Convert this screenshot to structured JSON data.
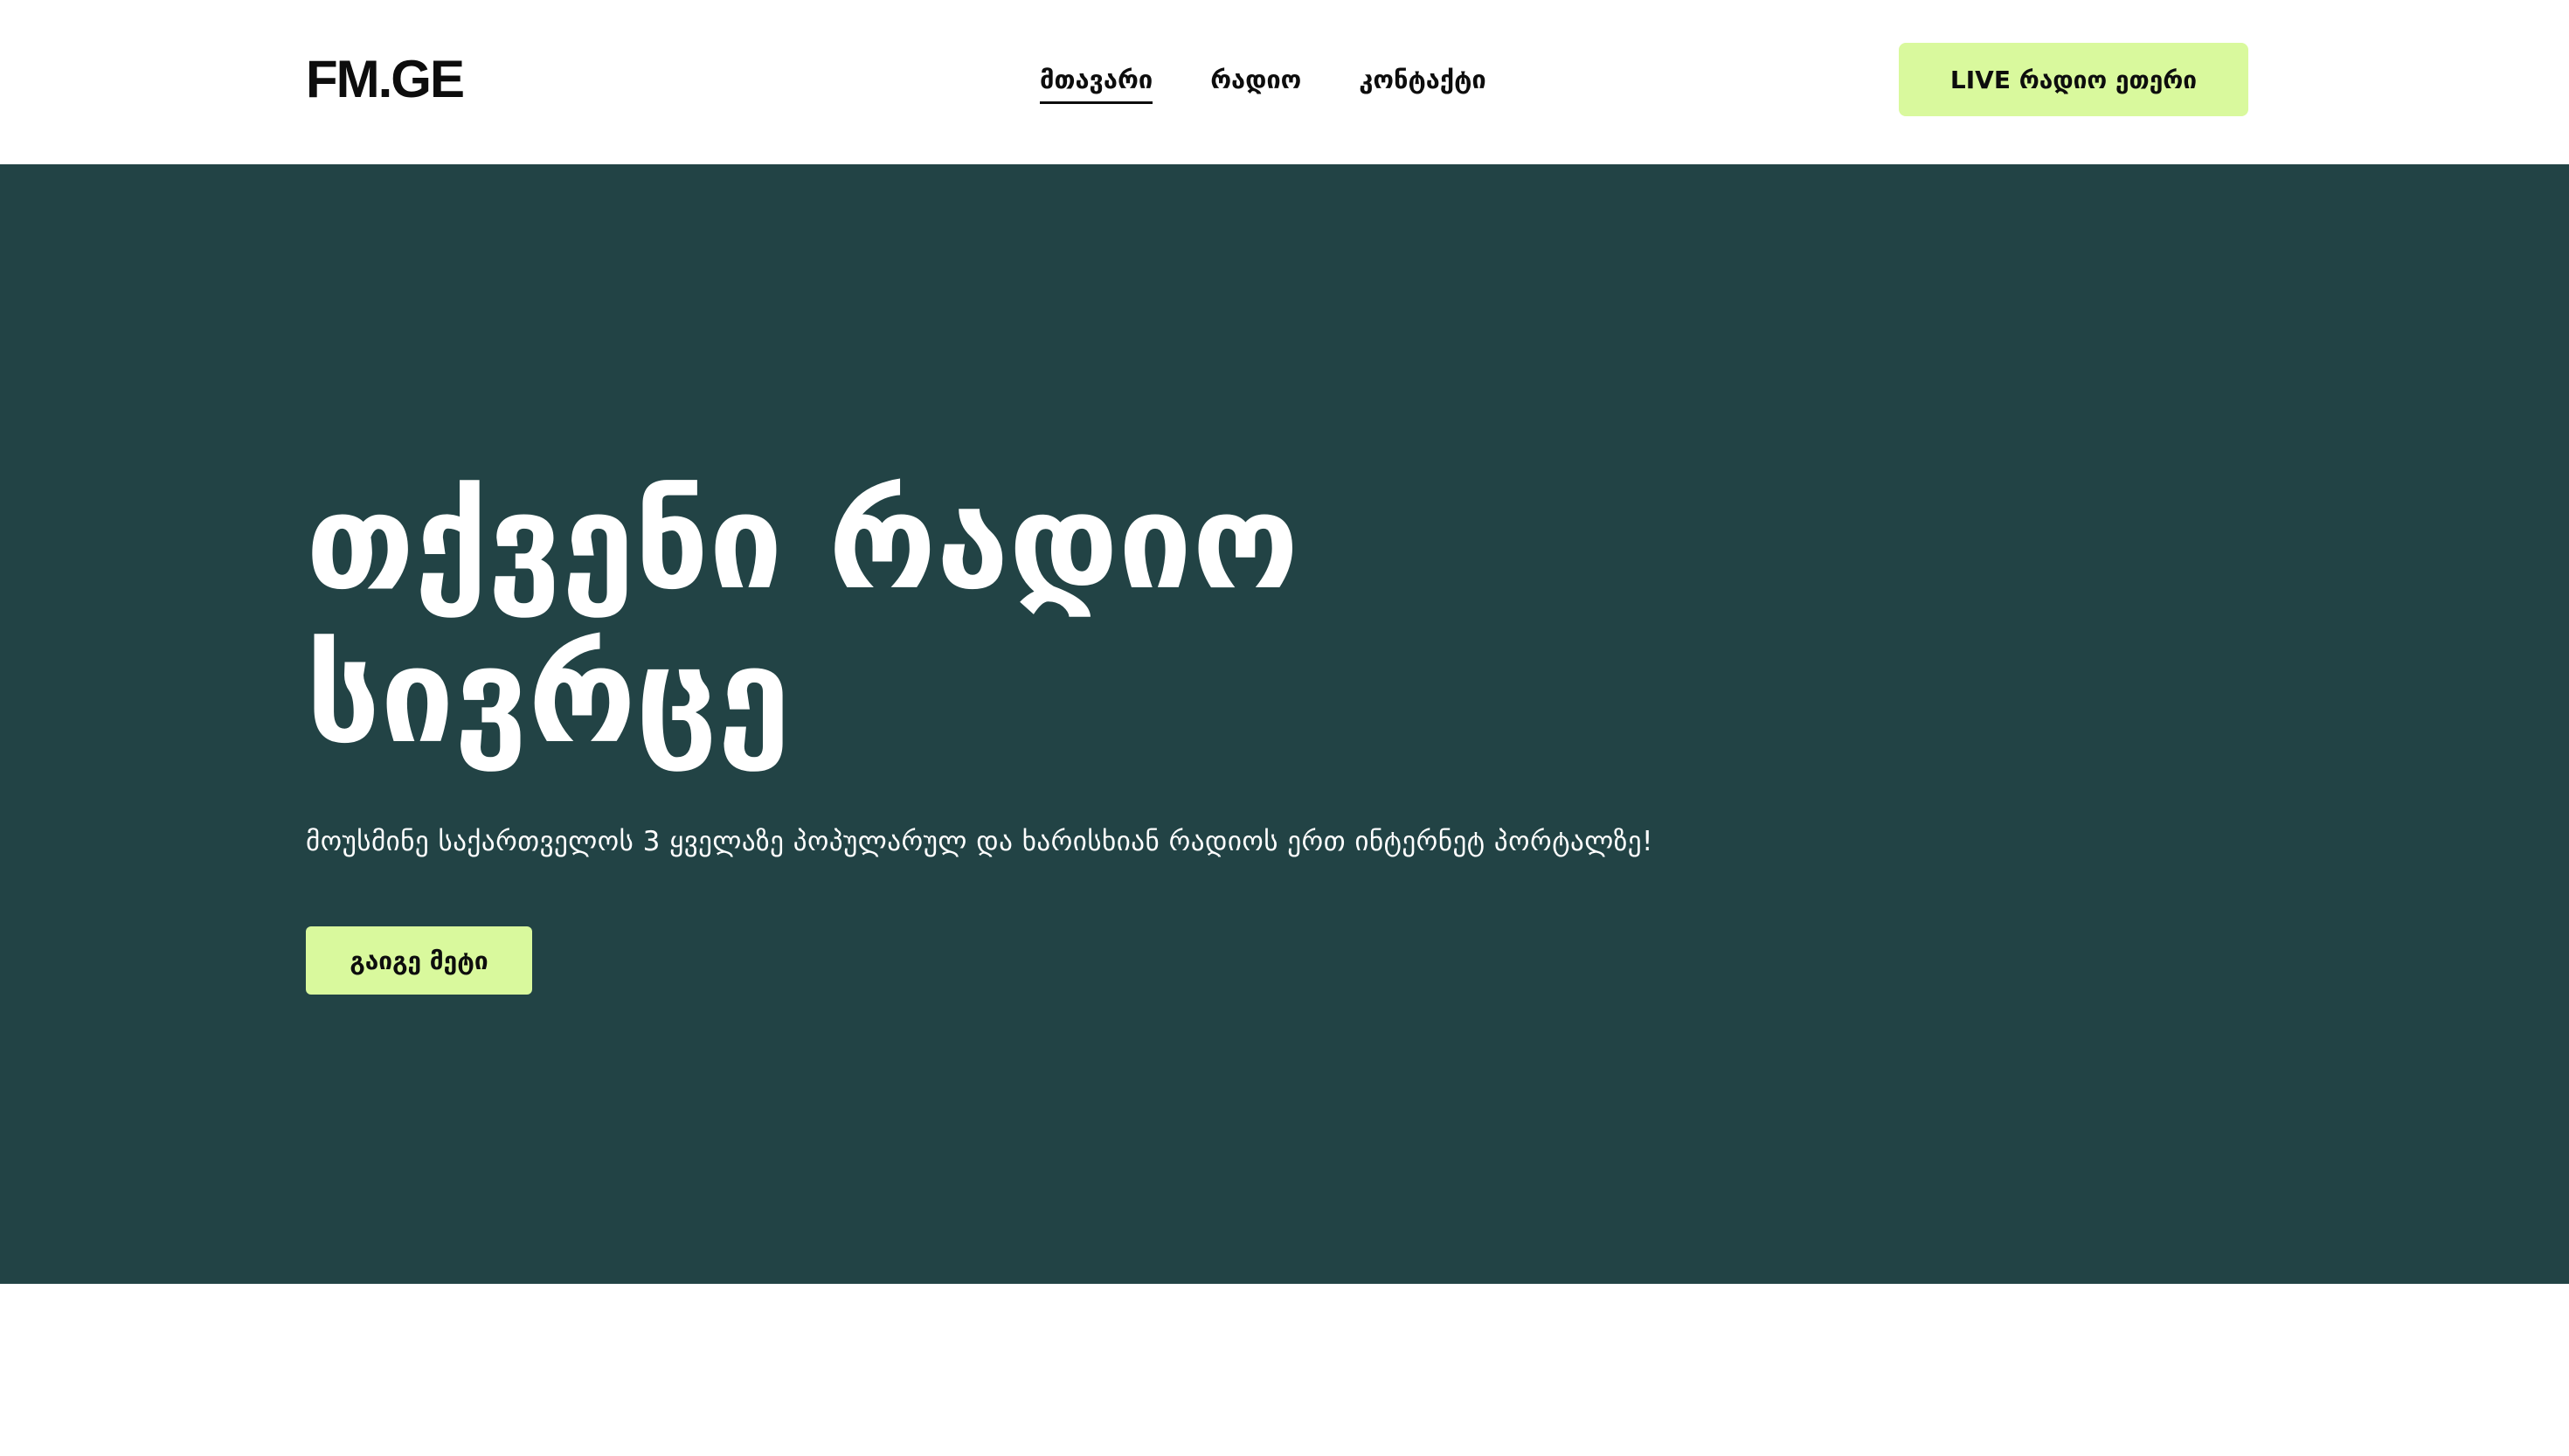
{
  "header": {
    "logo": "FM.GE",
    "nav": [
      {
        "label": "მთავარი",
        "active": true
      },
      {
        "label": "რადიო",
        "active": false
      },
      {
        "label": "კონტაქტი",
        "active": false
      }
    ],
    "cta_label": "LIVE რადიო ეთერი"
  },
  "hero": {
    "title": "თქვენი რადიო სივრცე",
    "subtitle": "მოუსმინე საქართველოს 3 ყველაზე პოპულარულ და ხარისხიან რადიოს ერთ ინტერნეტ პორტალზე!",
    "button_label": "გაიგე მეტი"
  },
  "colors": {
    "hero_bg": "#224345",
    "accent": "#d9f99d",
    "text_dark": "#0d0d0d",
    "text_light": "#ffffff"
  }
}
